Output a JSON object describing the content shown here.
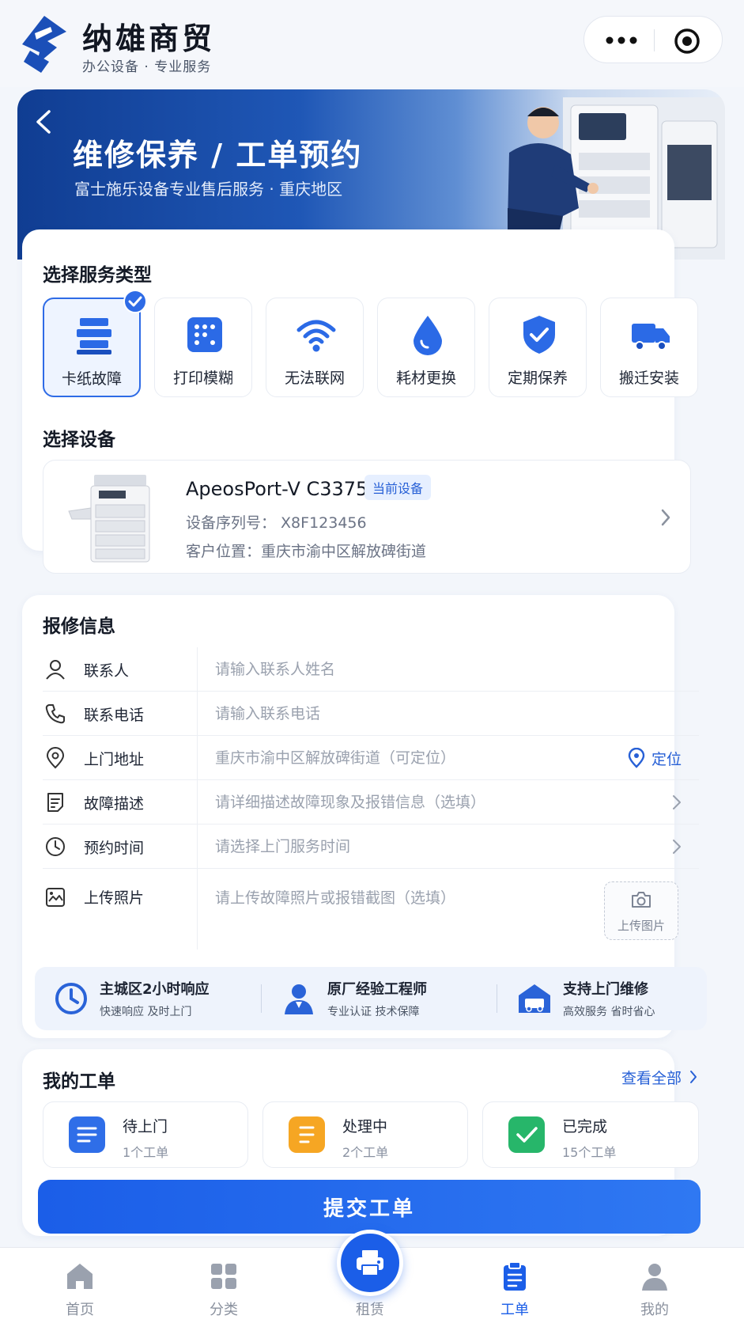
{
  "brand": {
    "name": "纳雄商贸",
    "tagline": "办公设备 · 专业服务"
  },
  "hero": {
    "title": "维修保养 / 工单预约",
    "subtitle": "富士施乐设备专业售后服务 · 重庆地区"
  },
  "service_types": {
    "title": "选择服务类型",
    "selected": "卡纸故障",
    "items": [
      {
        "label": "卡纸故障",
        "icon": "paper-stack-icon",
        "selected": true
      },
      {
        "label": "打印模糊",
        "icon": "dots-grid-icon",
        "selected": false
      },
      {
        "label": "无法联网",
        "icon": "wifi-icon",
        "selected": false
      },
      {
        "label": "耗材更换",
        "icon": "ink-drop-icon",
        "selected": false
      },
      {
        "label": "定期保养",
        "icon": "shield-check-icon",
        "selected": false
      },
      {
        "label": "搬迁安装",
        "icon": "truck-icon",
        "selected": false
      }
    ]
  },
  "device": {
    "title": "选择设备",
    "name": "ApeosPort-V C3375",
    "badge": "当前设备",
    "serial": "设备序列号：  X8F123456",
    "location": "客户位置：重庆市渝中区解放碑街道"
  },
  "repair_form": {
    "title": "报修信息",
    "rows": [
      {
        "label": "联系人",
        "placeholder": "请输入联系人姓名",
        "icon": "person-icon"
      },
      {
        "label": "联系电话",
        "placeholder": "请输入联系电话",
        "icon": "phone-icon"
      },
      {
        "label": "上门地址",
        "placeholder": "重庆市渝中区解放碑街道（可定位）",
        "icon": "location-pin-icon",
        "action": "定位"
      },
      {
        "label": "故障描述",
        "placeholder": "请详细描述故障现象及报错信息（选填）",
        "icon": "document-icon"
      },
      {
        "label": "预约时间",
        "placeholder": "请选择上门服务时间",
        "icon": "clock-icon"
      },
      {
        "label": "上传照片",
        "placeholder": "请上传故障照片或报错截图（选填）",
        "icon": "image-icon",
        "upload_label": "上传图片"
      }
    ]
  },
  "features": [
    {
      "title": "主城区2小时响应",
      "subtitle": "快速响应 及时上门",
      "icon": "clock-icon"
    },
    {
      "title": "原厂经验工程师",
      "subtitle": "专业认证 技术保障",
      "icon": "engineer-icon"
    },
    {
      "title": "支持上门维修",
      "subtitle": "高效服务 省时省心",
      "icon": "home-van-icon"
    }
  ],
  "orders": {
    "title": "我的工单",
    "view_all": "查看全部",
    "items": [
      {
        "label": "待上门",
        "count": "1个工单",
        "icon": "list-icon",
        "color": "#2f6ee8"
      },
      {
        "label": "处理中",
        "count": "2个工单",
        "icon": "doc-lines-icon",
        "color": "#f6a623"
      },
      {
        "label": "已完成",
        "count": "15个工单",
        "icon": "check-icon",
        "color": "#27b66a"
      }
    ]
  },
  "submit_label": "提交工单",
  "tabs": [
    {
      "label": "首页",
      "icon": "home-icon",
      "active": false
    },
    {
      "label": "分类",
      "icon": "grid-icon",
      "active": false
    },
    {
      "label": "租赁",
      "icon": "printer-icon",
      "active": false
    },
    {
      "label": "工单",
      "icon": "clipboard-icon",
      "active": true
    },
    {
      "label": "我的",
      "icon": "user-icon",
      "active": false
    }
  ],
  "colors": {
    "primary": "#1b5ee8",
    "hero_dark": "#103d92",
    "accent_text": "#2760d6",
    "pending": "#2f6ee8",
    "processing": "#f6a623",
    "done": "#27b66a"
  }
}
